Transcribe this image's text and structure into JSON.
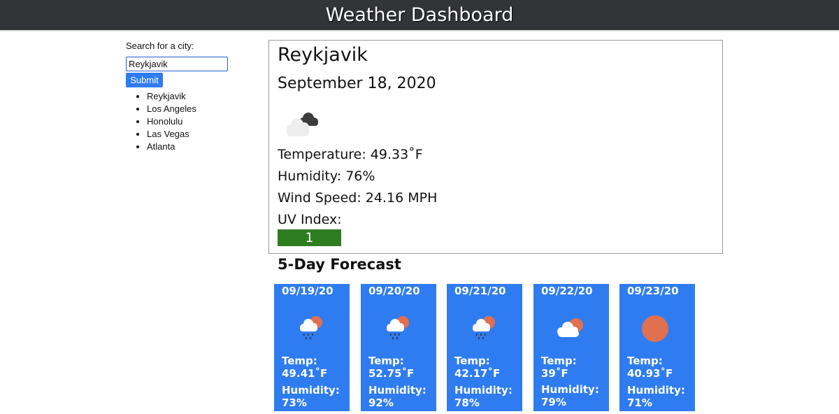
{
  "header": {
    "title": "Weather Dashboard"
  },
  "sidebar": {
    "search_label": "Search for a city:",
    "search_value": "Reykjavik",
    "submit_label": "Submit",
    "history": [
      "Reykjavik",
      "Los Angeles",
      "Honolulu",
      "Las Vegas",
      "Atlanta"
    ]
  },
  "current": {
    "city": "Reykjavik",
    "date": "September 18, 2020",
    "icon": "cloudy-icon",
    "temperature": "Temperature: 49.33˚F",
    "humidity": "Humidity: 76%",
    "wind": "Wind Speed: 24.16 MPH",
    "uv_label": "UV Index:",
    "uv_value": "1",
    "uv_color": "#2e7d20"
  },
  "forecast": {
    "title": "5-Day Forecast",
    "card_color": "#2f7cf0",
    "temp_label": "Temp:",
    "humidity_label": "Humidity:",
    "days": [
      {
        "date": "09/19/20",
        "icon": "rain-sun-icon",
        "temp": "49.41˚F",
        "humidity": "73%"
      },
      {
        "date": "09/20/20",
        "icon": "rain-sun-icon",
        "temp": "52.75˚F",
        "humidity": "92%"
      },
      {
        "date": "09/21/20",
        "icon": "rain-sun-icon",
        "temp": "42.17˚F",
        "humidity": "78%"
      },
      {
        "date": "09/22/20",
        "icon": "cloud-sun-icon",
        "temp_inline": "Temp: 39˚F",
        "humidity": "79%"
      },
      {
        "date": "09/23/20",
        "icon": "sun-icon",
        "temp": "40.93˚F",
        "humidity": "71%"
      }
    ]
  }
}
